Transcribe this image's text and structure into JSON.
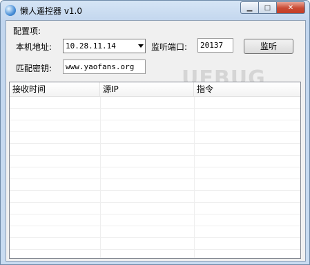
{
  "window": {
    "title": "懒人遥控器 v1.0"
  },
  "config": {
    "group_title": "配置项:",
    "local_address_label": "本机地址:",
    "local_address_value": "10.28.11.14",
    "listen_port_label": "监听端口:",
    "listen_port_value": "20137",
    "listen_button": "监听",
    "key_label": "匹配密钥:",
    "key_value": "www.yaofans.org"
  },
  "watermark": "UEBUG",
  "list": {
    "columns": [
      "接收时间",
      "源IP",
      "指令"
    ],
    "rows": []
  },
  "icons": {
    "app": "app-icon",
    "minimize": "minimize-icon",
    "maximize": "maximize-icon",
    "close": "close-icon"
  }
}
